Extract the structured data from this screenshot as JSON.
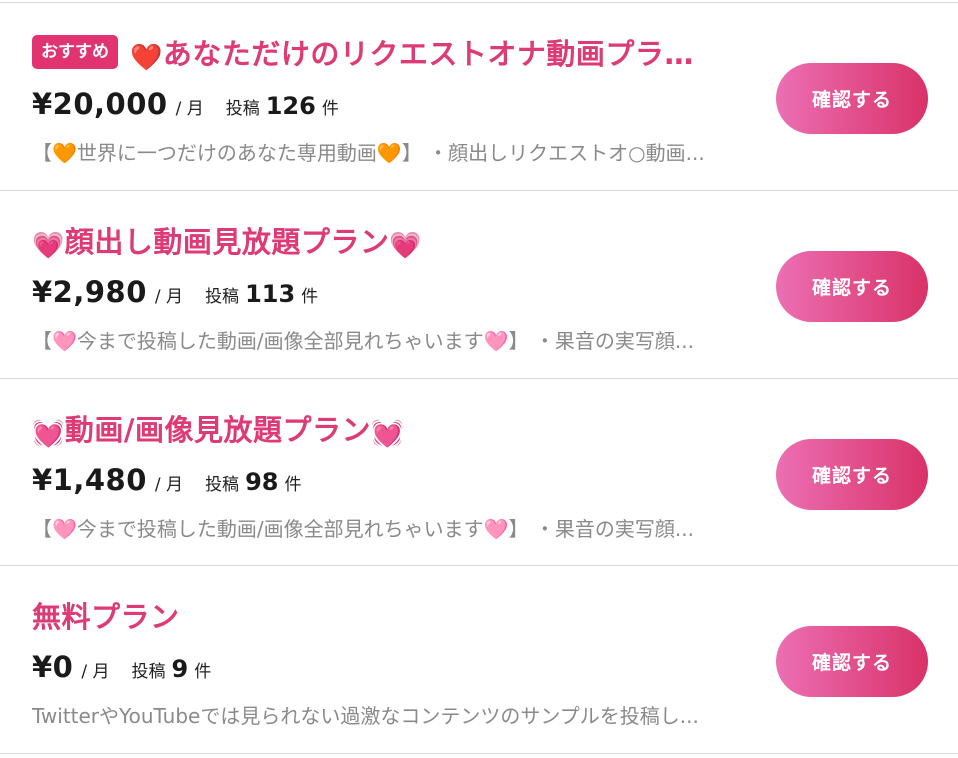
{
  "plans": [
    {
      "badge": "おすすめ",
      "title_emoji": "❤️",
      "title": "あなただけのリクエストオナ動画プラン...",
      "title_suffix_emoji": "",
      "price": "¥20,000",
      "per_month": "/ 月",
      "posts_label": "投稿",
      "posts_count": "126",
      "posts_unit": "件",
      "description": "【🧡世界に一つだけのあなた専用動画🧡】 ・顔出しリクエストオ○動画...",
      "button_label": "確認する"
    },
    {
      "badge": "",
      "title_emoji": "💗",
      "title": "顔出し動画見放題プラン",
      "title_suffix_emoji": "💗",
      "price": "¥2,980",
      "per_month": "/ 月",
      "posts_label": "投稿",
      "posts_count": "113",
      "posts_unit": "件",
      "description": "【🩷今まで投稿した動画/画像全部見れちゃいます🩷】 ・果音の実写顔...",
      "button_label": "確認する"
    },
    {
      "badge": "",
      "title_emoji": "💓",
      "title": "動画/画像見放題プラン",
      "title_suffix_emoji": "💓",
      "price": "¥1,480",
      "per_month": "/ 月",
      "posts_label": "投稿",
      "posts_count": "98",
      "posts_unit": "件",
      "description": "【🩷今まで投稿した動画/画像全部見れちゃいます🩷】 ・果音の実写顔...",
      "button_label": "確認する"
    },
    {
      "badge": "",
      "title_emoji": "",
      "title": "無料プラン",
      "title_suffix_emoji": "",
      "price": "¥0",
      "per_month": "/ 月",
      "posts_label": "投稿",
      "posts_count": "9",
      "posts_unit": "件",
      "description": "TwitterやYouTubeでは見られない過激なコンテンツのサンプルを投稿し...",
      "button_label": "確認する"
    }
  ],
  "colors": {
    "title_pink": "#dd3a76",
    "badge_pink": "#e0336f",
    "button_gradient_start": "#ec6fb3",
    "button_gradient_end": "#d93268",
    "description_gray": "#8a8a8a",
    "divider_gray": "#d9d9d9"
  }
}
